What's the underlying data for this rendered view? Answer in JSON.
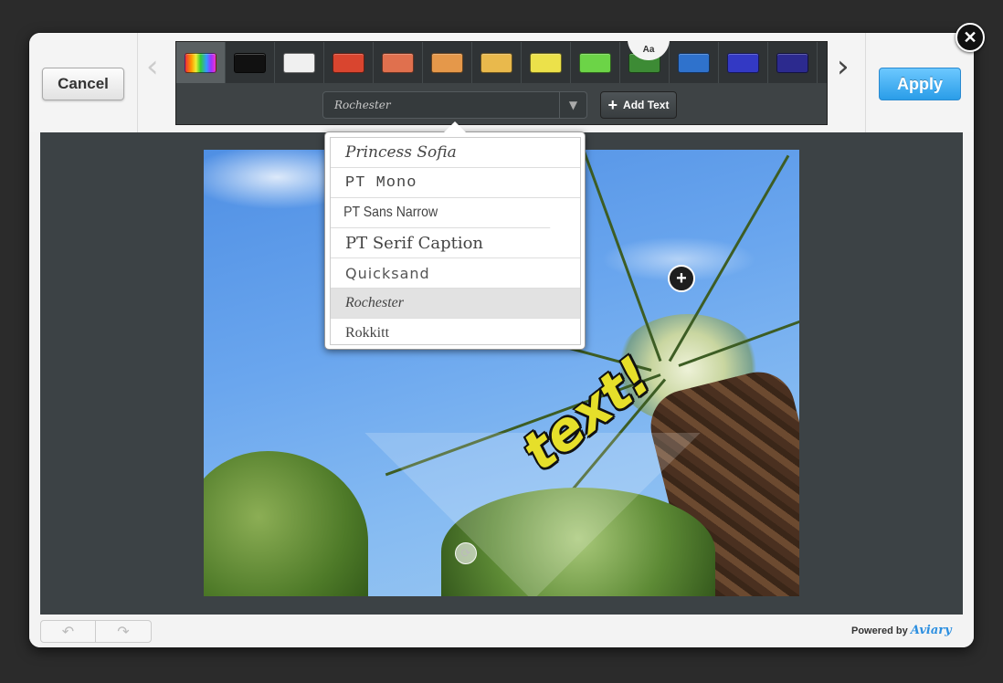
{
  "header": {
    "cancel_label": "Cancel",
    "apply_label": "Apply",
    "font_tab_label": "Aa",
    "close_label": "✕"
  },
  "colors": {
    "accent": "#2a9de8",
    "swatches": [
      {
        "name": "rainbow",
        "color": "rainbow",
        "selected": true
      },
      {
        "name": "black",
        "color": "#111111"
      },
      {
        "name": "white",
        "color": "#f0f0f0"
      },
      {
        "name": "red",
        "color": "#d9452f"
      },
      {
        "name": "coral",
        "color": "#e0704e"
      },
      {
        "name": "orange",
        "color": "#e5984a"
      },
      {
        "name": "gold",
        "color": "#e9b94c"
      },
      {
        "name": "yellow",
        "color": "#ece14a"
      },
      {
        "name": "green",
        "color": "#6cd447"
      },
      {
        "name": "dark-green",
        "color": "#3d8b35"
      },
      {
        "name": "blue",
        "color": "#2f72cc"
      },
      {
        "name": "indigo",
        "color": "#3339c4"
      },
      {
        "name": "navy",
        "color": "#2c2a8e"
      }
    ]
  },
  "font_picker": {
    "selected_font": "Rochester",
    "add_text_label": "Add Text",
    "options": [
      {
        "label": "Princess Sofia",
        "selected": false
      },
      {
        "label": "PT Mono",
        "selected": false
      },
      {
        "label": "PT Sans Narrow",
        "selected": false
      },
      {
        "label": "PT Serif Caption",
        "selected": false
      },
      {
        "label": "Quicksand",
        "selected": false
      },
      {
        "label": "Rochester",
        "selected": true
      },
      {
        "label": "Rokkitt",
        "selected": false
      }
    ]
  },
  "canvas": {
    "overlay_text": "text!"
  },
  "footer": {
    "powered_by": "Powered by",
    "brand": "Aviary",
    "undo_icon": "undo-icon",
    "redo_icon": "redo-icon"
  }
}
